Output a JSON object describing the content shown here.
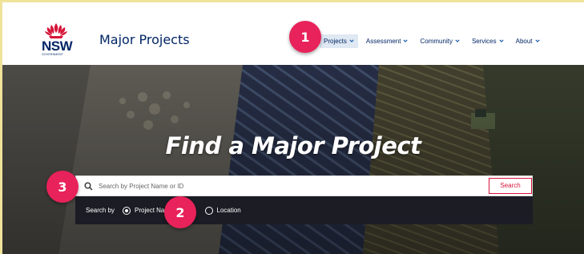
{
  "header": {
    "logo_text": "NSW",
    "logo_sub": "GOVERNMENT",
    "site_title": "Major Projects",
    "nav": [
      {
        "label": "Projects",
        "active": true
      },
      {
        "label": "Assessment",
        "active": false
      },
      {
        "label": "Community",
        "active": false
      },
      {
        "label": "Services",
        "active": false
      },
      {
        "label": "About",
        "active": false
      }
    ]
  },
  "hero": {
    "title": "Find a Major Project",
    "search": {
      "placeholder": "Search by Project Name or ID",
      "button_label": "Search"
    },
    "search_by": {
      "label": "Search by",
      "options": [
        {
          "label": "Project Name",
          "checked": true
        },
        {
          "label": "Location",
          "checked": false
        }
      ]
    }
  },
  "callouts": [
    "1",
    "2",
    "3"
  ],
  "colors": {
    "brand_navy": "#002664",
    "accent_red": "#d7153a",
    "callout_pink": "#e8225a",
    "nav_active_bg": "#dfe8f3",
    "searchby_bg": "#1b1c24"
  },
  "icons": {
    "logo": "waratah-icon",
    "search": "search-icon",
    "dropdown": "chevron-down-icon"
  }
}
